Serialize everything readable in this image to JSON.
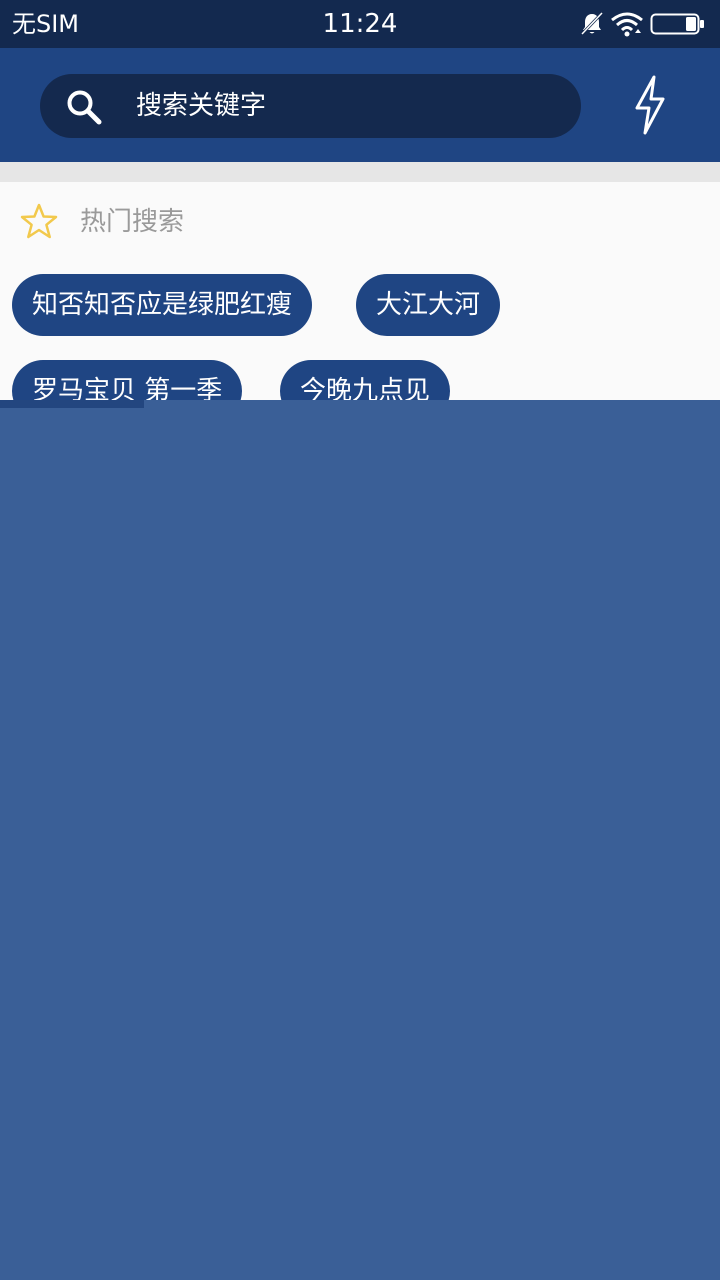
{
  "status_bar": {
    "carrier": "无SIM",
    "time": "11:24",
    "icons": [
      "bell-muted-icon",
      "wifi-icon",
      "battery-icon"
    ],
    "battery_level": 0.25
  },
  "search": {
    "placeholder": "搜索关键字",
    "search_icon": "search-icon",
    "action_icon": "flash-icon"
  },
  "hot_search": {
    "icon": "star-icon",
    "title": "热门搜索",
    "tags": [
      "知否知否应是绿肥红瘦",
      "大江大河",
      "罗马宝贝 第一季",
      "今晚九点见"
    ]
  },
  "colors": {
    "status_bar": "#13294f",
    "app_bar": "#1f4583",
    "search_box": "#14294e",
    "tag_background": "#1f4583",
    "star": "#f2c94c",
    "overlay": "#3a5f97"
  }
}
